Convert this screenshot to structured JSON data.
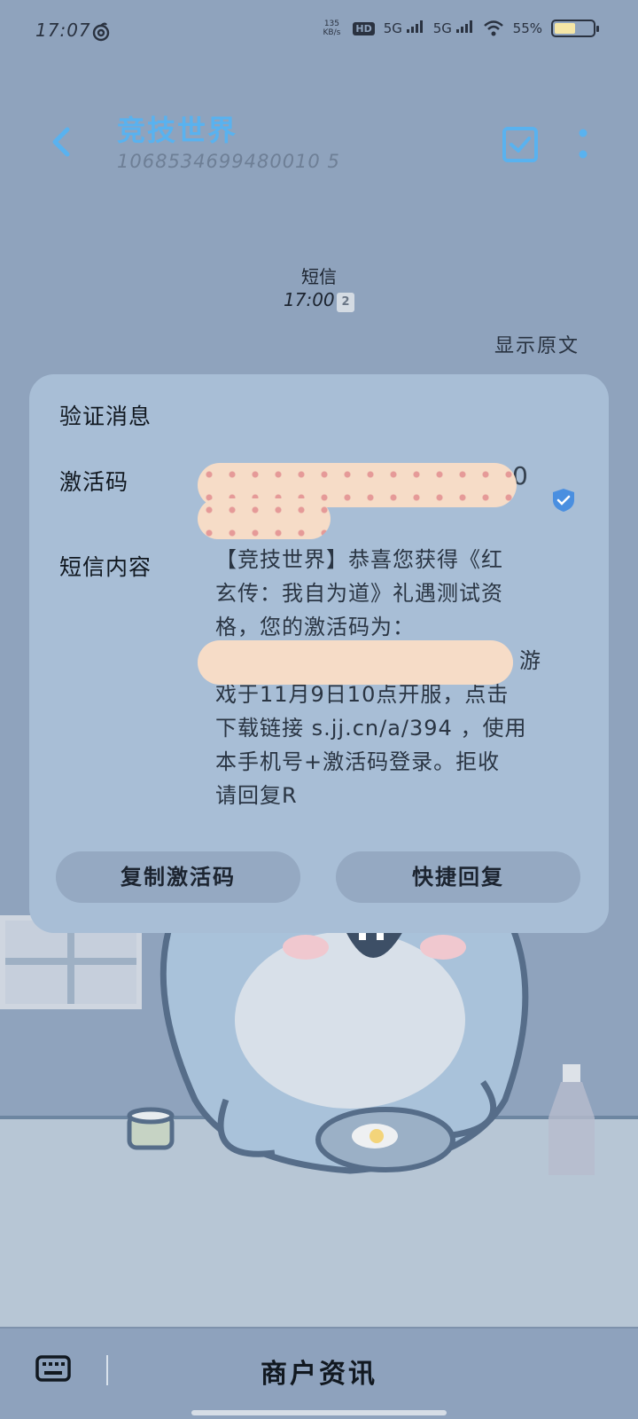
{
  "status_bar": {
    "time": "17:07",
    "net_speed_value": "135",
    "net_speed_unit": "KB/s",
    "hd_label": "HD",
    "signal1": "5G",
    "signal2": "5G",
    "battery": "55%",
    "battery_level": 0.55
  },
  "header": {
    "title": "竞技世界",
    "number": "1068534699480010 5"
  },
  "message_meta": {
    "type_label": "短信",
    "time": "17:00",
    "sim_badge": "2",
    "show_original": "显示原文"
  },
  "card": {
    "title": "验证消息",
    "code_label": "激活码",
    "code_value_visible": "0",
    "content_label": "短信内容",
    "content_lines": [
      "【竞技世界】恭喜您获得《红",
      "玄传：我自为道》礼遇测试资",
      "格，您的激活码为：",
      "。游",
      "戏于11月9日10点开服，点击",
      "下载链接 s.jj.cn/a/394 ，使用",
      "本手机号+激活码登录。拒收",
      "请回复R"
    ],
    "copy_button": "复制激活码",
    "reply_button": "快捷回复"
  },
  "bottom_bar": {
    "merchant_label": "商户资讯"
  },
  "colors": {
    "background": "#8fa3bd",
    "accent": "#59b2ef",
    "card": "#a8bed6",
    "button": "#95a9c2"
  },
  "icons": {
    "back": "chevron-left-icon",
    "select": "checkbox-icon",
    "more": "more-vertical-icon",
    "verified": "shield-check-icon",
    "keyboard": "keyboard-icon"
  }
}
